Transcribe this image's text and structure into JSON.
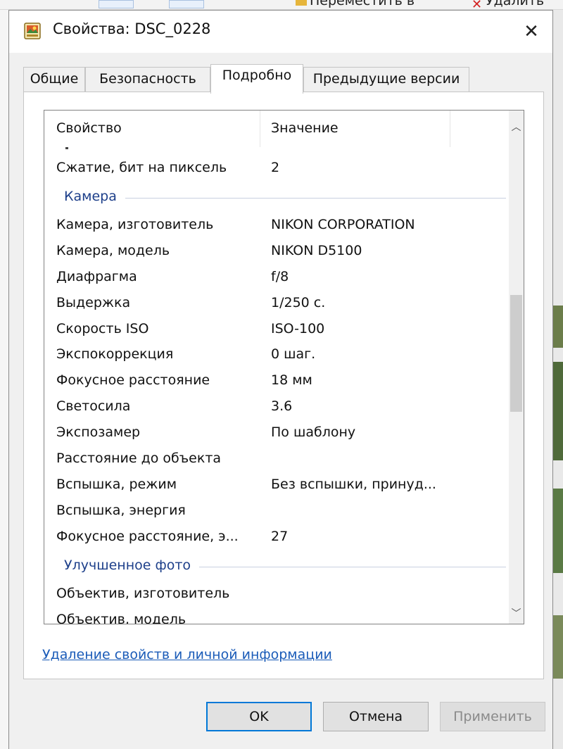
{
  "background": {
    "move_label": "Переместить в",
    "delete_label": "Удалить"
  },
  "dialog": {
    "title": "Свойства: DSC_0228",
    "close_glyph": "✕"
  },
  "tabs": [
    {
      "label": "Общие"
    },
    {
      "label": "Безопасность"
    },
    {
      "label": "Подробно"
    },
    {
      "label": "Предыдущие версии"
    }
  ],
  "active_tab": "Подробно",
  "list": {
    "col_property": "Свойство",
    "col_value": "Значение",
    "rows": [
      {
        "k": "Сжатие, бит на пиксель",
        "v": "2"
      },
      {
        "group": "Камера"
      },
      {
        "k": "Камера, изготовитель",
        "v": "NIKON CORPORATION"
      },
      {
        "k": "Камера, модель",
        "v": "NIKON D5100"
      },
      {
        "k": "Диафрагма",
        "v": "f/8"
      },
      {
        "k": "Выдержка",
        "v": "1/250 с."
      },
      {
        "k": "Скорость ISO",
        "v": "ISO-100"
      },
      {
        "k": "Экспокоррекция",
        "v": "0 шаг."
      },
      {
        "k": "Фокусное расстояние",
        "v": "18 мм"
      },
      {
        "k": "Светосила",
        "v": "3.6"
      },
      {
        "k": "Экспозамер",
        "v": "По шаблону"
      },
      {
        "k": "Расстояние до объекта",
        "v": ""
      },
      {
        "k": "Вспышка, режим",
        "v": "Без вспышки, принуд..."
      },
      {
        "k": "Вспышка, энергия",
        "v": ""
      },
      {
        "k": "Фокусное расстояние, э...",
        "v": "27"
      },
      {
        "group": "Улучшенное фото"
      },
      {
        "k": "Объектив, изготовитель",
        "v": ""
      },
      {
        "k": "Объектив, модель",
        "v": ""
      }
    ]
  },
  "remove_link": "Удаление свойств и личной информации",
  "buttons": {
    "ok": "OK",
    "cancel": "Отмена",
    "apply": "Применить"
  }
}
